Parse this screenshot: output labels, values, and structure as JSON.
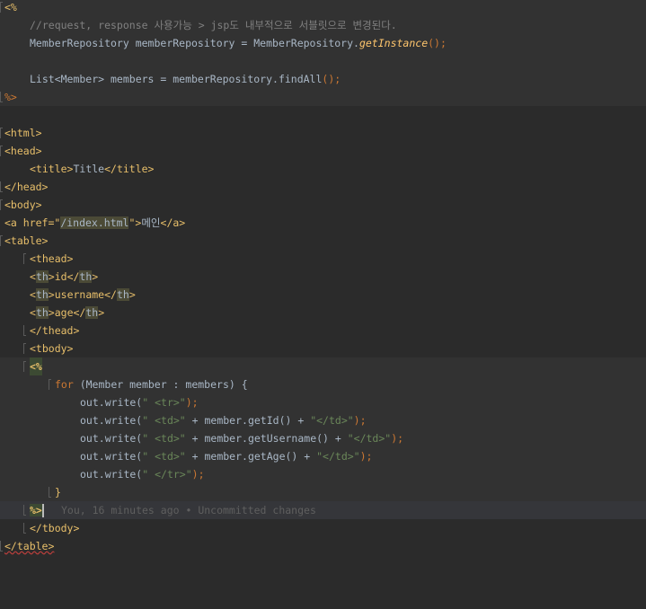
{
  "lines": {
    "l01": "<%",
    "l02": "//request, response 사용가능 > jsp도 내부적으로 서블릿으로 변경된다.",
    "l03a": "MemberRepository memberRepository = MemberRepository.",
    "l03b": "getInstance",
    "l03c": "();",
    "l05a": "List<Member> members = memberRepository.findAll",
    "l05b": "();",
    "l06": "%>",
    "l08": "<html>",
    "l09": "<head>",
    "l10a": "<title>",
    "l10b": "Title",
    "l10c": "</title>",
    "l11": "</head>",
    "l12": "<body>",
    "l13a": "<a href=\"",
    "l13b": "/index.html",
    "l13c": "\">",
    "l13d": "메인",
    "l13e": "</a>",
    "l14": "<table>",
    "l15": "<thead>",
    "l16a": "<",
    "l16b": "th",
    "l16c": ">id</",
    "l16d": "th",
    "l16e": ">",
    "l17a": "<",
    "l17b": "th",
    "l17c": ">username</",
    "l17d": "th",
    "l17e": ">",
    "l18a": "<",
    "l18b": "th",
    "l18c": ">age</",
    "l18d": "th",
    "l18e": ">",
    "l19": "</thead>",
    "l20": "<tbody>",
    "l21": "<%",
    "l22a": "for",
    "l22b": " (Member member : members) {",
    "l23a": "out.write(",
    "l23b": "\" <tr>\"",
    "l23c": ");",
    "l24a": "out.write(",
    "l24b": "\" <td>\"",
    "l24c": " + member.getId() + ",
    "l24d": "\"</td>\"",
    "l24e": ");",
    "l25a": "out.write(",
    "l25b": "\" <td>\"",
    "l25c": " + member.getUsername() + ",
    "l25d": "\"</td>\"",
    "l25e": ");",
    "l26a": "out.write(",
    "l26b": "\" <td>\"",
    "l26c": " + member.getAge() + ",
    "l26d": "\"</td>\"",
    "l26e": ");",
    "l27a": "out.write(",
    "l27b": "\" </tr>\"",
    "l27c": ");",
    "l28": "}",
    "l29": "%>",
    "l29_blame": "You, 16 minutes ago • Uncommitted changes",
    "l30": "</tbody>",
    "l31": "</table>"
  }
}
